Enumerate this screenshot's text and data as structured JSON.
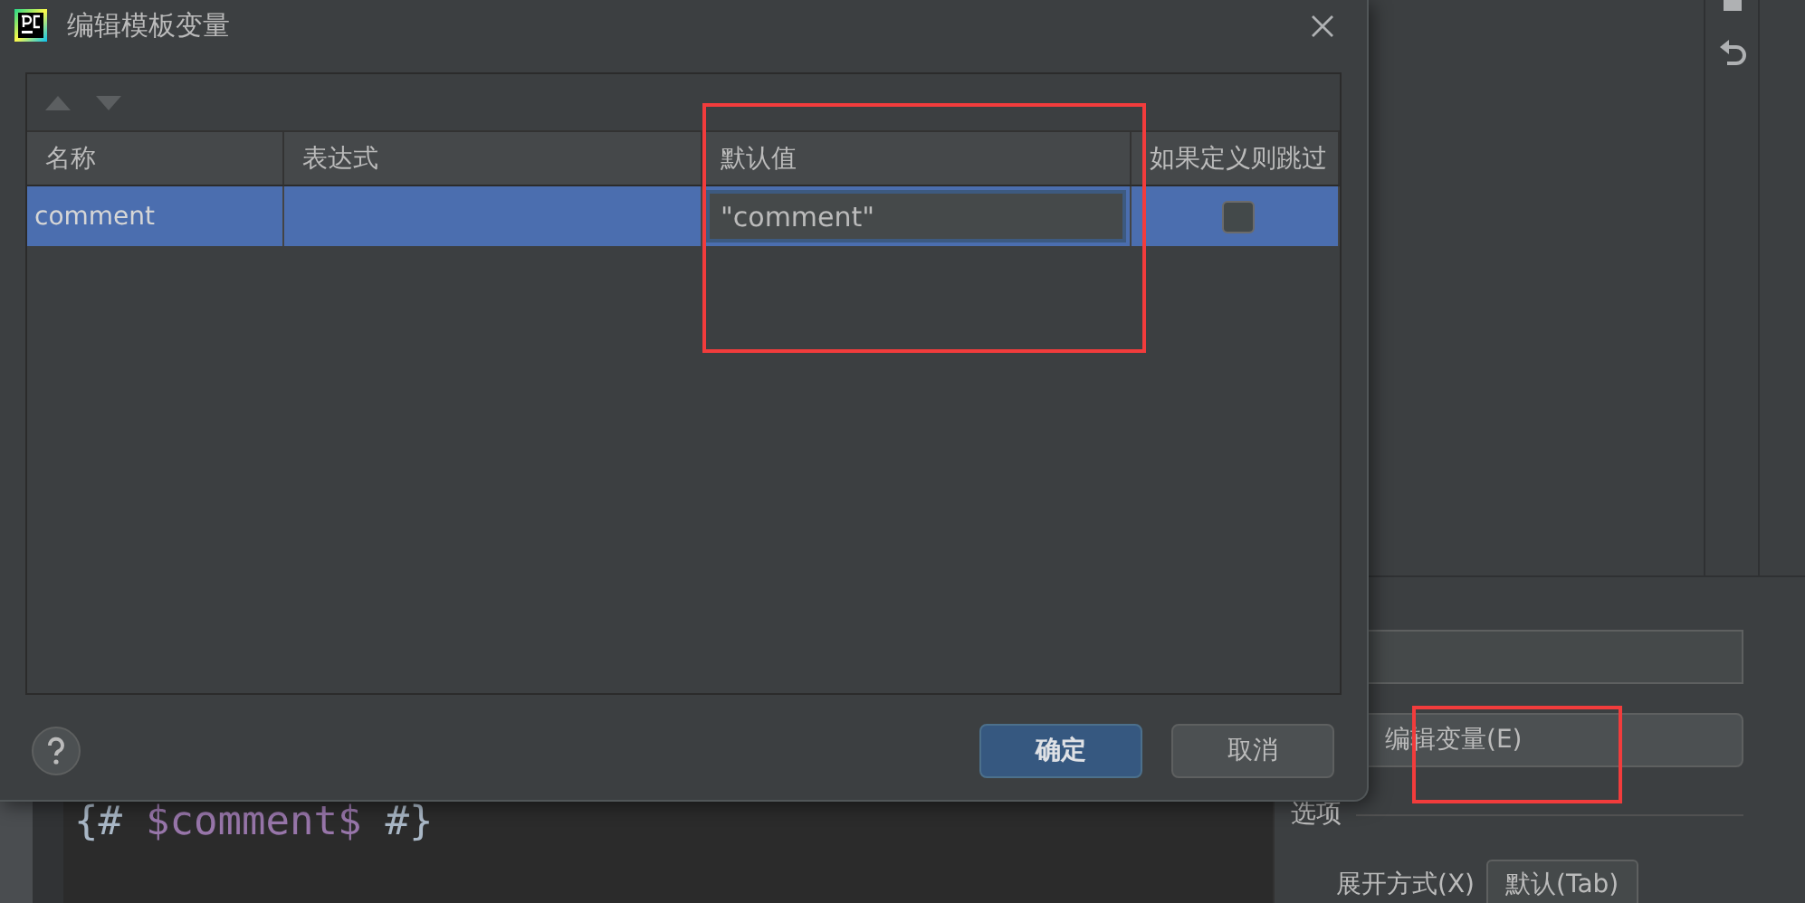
{
  "window": {
    "title": "编辑模板变量"
  },
  "toolbar": [
    {
      "kind": "move-up",
      "disabled": true
    },
    {
      "kind": "move-down",
      "disabled": true
    }
  ],
  "table": {
    "columns": [
      "名称",
      "表达式",
      "默认值",
      "如果定义则跳过"
    ],
    "rows": [
      {
        "name": "comment",
        "default_value": "\"comment\"",
        "skip_if_defined": false,
        "selected": true
      }
    ]
  },
  "buttons": [
    {
      "label": "确定",
      "primary": true
    },
    {
      "label": "取消",
      "primary": false
    }
  ],
  "background": {
    "editor_code": [
      {
        "text": "{#",
        "kind": "delimiter"
      },
      {
        "text": "$comment$",
        "kind": "variable"
      },
      {
        "text": "#}",
        "kind": "delimiter"
      }
    ],
    "edit_variables_button": "编辑变量(E)",
    "options_section": "选项",
    "expand_label": "展开方式(X)",
    "expand_dropdown": "默认(Tab)"
  }
}
